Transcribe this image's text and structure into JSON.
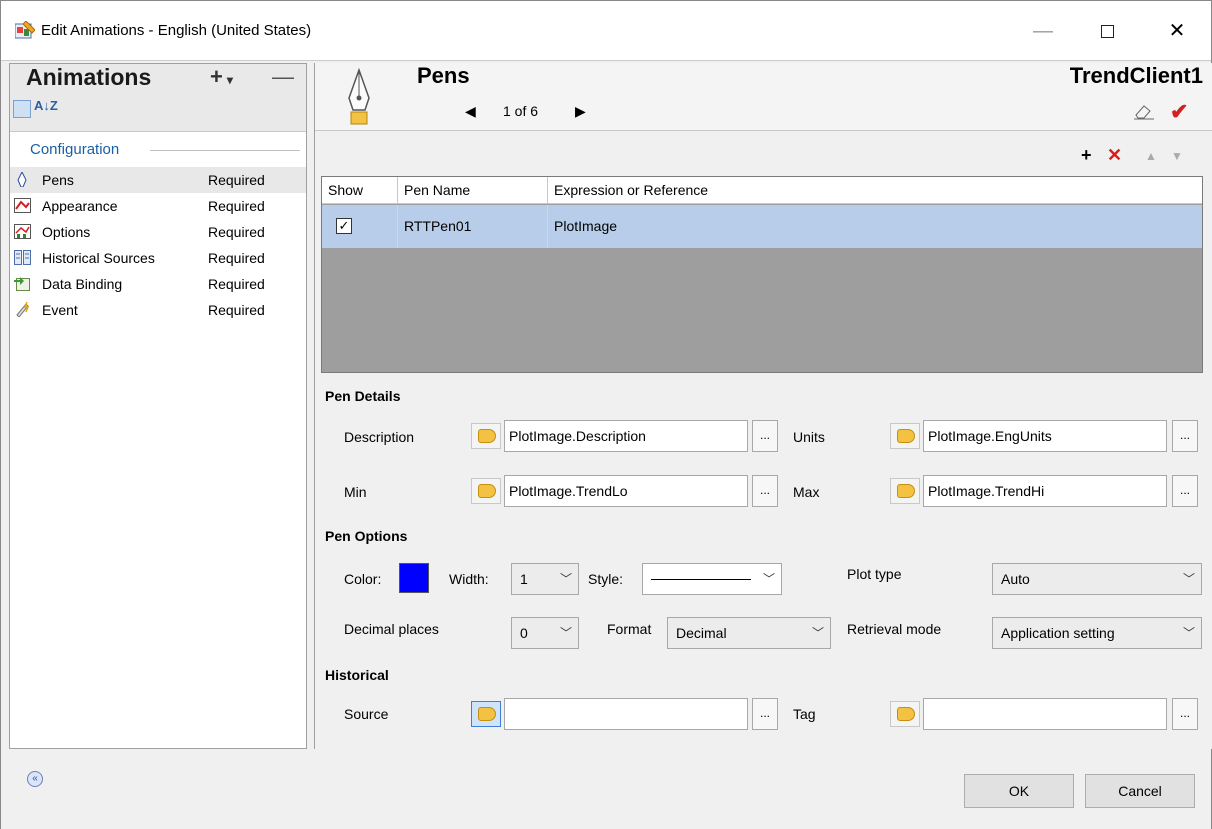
{
  "window": {
    "title": "Edit Animations - English (United States)",
    "minimize": "—",
    "close": "✕"
  },
  "left": {
    "title": "Animations",
    "add": "+",
    "add_dropdown": "▾",
    "remove": "—",
    "az": "A↓Z",
    "category": "Configuration",
    "items": [
      {
        "label": "Pens",
        "status": "Required"
      },
      {
        "label": "Appearance",
        "status": "Required"
      },
      {
        "label": "Options",
        "status": "Required"
      },
      {
        "label": "Historical Sources",
        "status": "Required"
      },
      {
        "label": "Data Binding",
        "status": "Required"
      },
      {
        "label": "Event",
        "status": "Required"
      }
    ]
  },
  "header": {
    "title": "Pens",
    "pager_prev": "◀",
    "pager": "1 of 6",
    "pager_next": "▶",
    "client": "TrendClient1",
    "check": "✔"
  },
  "grid_tools": {
    "add": "+",
    "delete": "✕",
    "up": "▲",
    "down": "▼"
  },
  "grid": {
    "columns": [
      "Show",
      "Pen Name",
      "Expression or Reference"
    ],
    "rows": [
      {
        "show": "✓",
        "name": "RTTPen01",
        "expression": "PlotImage"
      }
    ]
  },
  "pen_details": {
    "heading": "Pen Details",
    "description_label": "Description",
    "description_value": "PlotImage.Description",
    "units_label": "Units",
    "units_value": "PlotImage.EngUnits",
    "min_label": "Min",
    "min_value": "PlotImage.TrendLo",
    "max_label": "Max",
    "max_value": "PlotImage.TrendHi",
    "dots": "..."
  },
  "pen_options": {
    "heading": "Pen Options",
    "color_label": "Color:",
    "color": "#0000ff",
    "width_label": "Width:",
    "width_value": "1",
    "style_label": "Style:",
    "plot_type_label": "Plot type",
    "plot_type_value": "Auto",
    "decimal_label": "Decimal places",
    "decimal_value": "0",
    "format_label": "Format",
    "format_value": "Decimal",
    "retrieval_label": "Retrieval mode",
    "retrieval_value": "Application setting",
    "arrow": "﹀"
  },
  "historical": {
    "heading": "Historical",
    "source_label": "Source",
    "source_value": "",
    "tag_label": "Tag",
    "tag_value": ""
  },
  "footer": {
    "collapse": "«",
    "ok": "OK",
    "cancel": "Cancel"
  }
}
